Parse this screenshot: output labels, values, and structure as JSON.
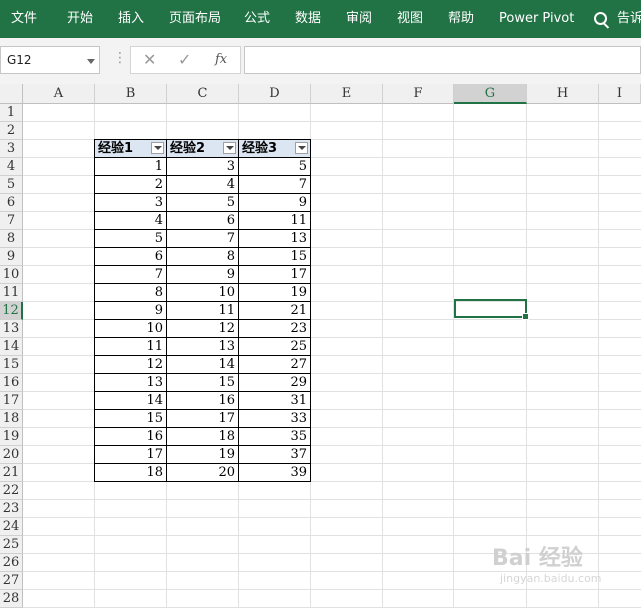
{
  "ribbon": {
    "tabs": [
      "文件",
      "开始",
      "插入",
      "页面布局",
      "公式",
      "数据",
      "审阅",
      "视图",
      "帮助",
      "Power Pivot"
    ],
    "tell_me": "告诉"
  },
  "formula_bar": {
    "name_box": "G12",
    "cancel": "✕",
    "enter": "✓",
    "fx": "fx",
    "value": ""
  },
  "columns": [
    "A",
    "B",
    "C",
    "D",
    "E",
    "F",
    "G",
    "H",
    "I"
  ],
  "rows": [
    "1",
    "2",
    "3",
    "4",
    "5",
    "6",
    "7",
    "8",
    "9",
    "10",
    "11",
    "12",
    "13",
    "14",
    "15",
    "16",
    "17",
    "18",
    "19",
    "20",
    "21",
    "22",
    "23",
    "24",
    "25",
    "26",
    "27",
    "28"
  ],
  "selected_cell": "G12",
  "table": {
    "headers": [
      "经验1",
      "经验2",
      "经验3"
    ],
    "data": [
      [
        "1",
        "3",
        "5"
      ],
      [
        "2",
        "4",
        "7"
      ],
      [
        "3",
        "5",
        "9"
      ],
      [
        "4",
        "6",
        "11"
      ],
      [
        "5",
        "7",
        "13"
      ],
      [
        "6",
        "8",
        "15"
      ],
      [
        "7",
        "9",
        "17"
      ],
      [
        "8",
        "10",
        "19"
      ],
      [
        "9",
        "11",
        "21"
      ],
      [
        "10",
        "12",
        "23"
      ],
      [
        "11",
        "13",
        "25"
      ],
      [
        "12",
        "14",
        "27"
      ],
      [
        "13",
        "15",
        "29"
      ],
      [
        "14",
        "16",
        "31"
      ],
      [
        "15",
        "17",
        "33"
      ],
      [
        "16",
        "18",
        "35"
      ],
      [
        "17",
        "19",
        "37"
      ],
      [
        "18",
        "20",
        "39"
      ]
    ]
  },
  "watermark": {
    "main": "Bai 经验",
    "sub": "jingyan.baidu.com"
  },
  "colors": {
    "accent": "#217346",
    "table_header": "#dce6f2"
  }
}
